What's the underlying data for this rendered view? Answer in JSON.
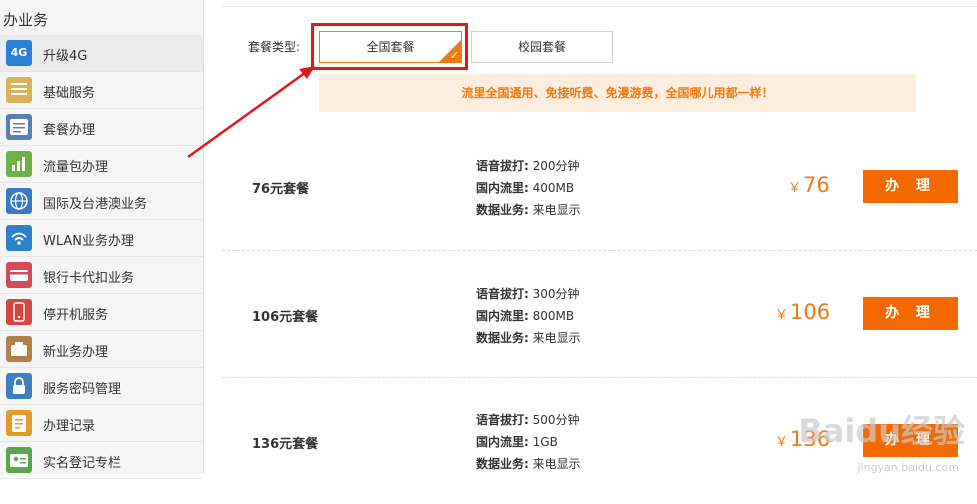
{
  "sidebar": {
    "title": "办业务",
    "items": [
      {
        "label": "升级4G",
        "icon": "4g-icon",
        "icon_text": "4G",
        "color": "#2a7fd4",
        "active": true
      },
      {
        "label": "基础服务",
        "icon": "basic-service-icon",
        "icon_text": "",
        "color": "#d9b25a",
        "active": false
      },
      {
        "label": "套餐办理",
        "icon": "plan-list-icon",
        "icon_text": "",
        "color": "#5a7fb2",
        "active": false
      },
      {
        "label": "流量包办理",
        "icon": "data-pack-icon",
        "icon_text": "",
        "color": "#6fb048",
        "active": false
      },
      {
        "label": "国际及台港澳业务",
        "icon": "globe-icon",
        "icon_text": "",
        "color": "#3a78c2",
        "active": false
      },
      {
        "label": "WLAN业务办理",
        "icon": "wlan-icon",
        "icon_text": "",
        "color": "#2c82c9",
        "active": false
      },
      {
        "label": "银行卡代扣业务",
        "icon": "bank-card-icon",
        "icon_text": "",
        "color": "#d24b5a",
        "active": false
      },
      {
        "label": "停开机服务",
        "icon": "phone-power-icon",
        "icon_text": "",
        "color": "#d4473e",
        "active": false
      },
      {
        "label": "新业务办理",
        "icon": "new-service-icon",
        "icon_text": "",
        "color": "#b08048",
        "active": false
      },
      {
        "label": "服务密码管理",
        "icon": "password-icon",
        "icon_text": "",
        "color": "#3d7fc1",
        "active": false
      },
      {
        "label": "办理记录",
        "icon": "record-icon",
        "icon_text": "",
        "color": "#e59b2a",
        "active": false
      },
      {
        "label": "实名登记专栏",
        "icon": "realname-icon",
        "icon_text": "",
        "color": "#5aa64a",
        "active": false
      }
    ]
  },
  "package_type": {
    "label": "套餐类型:",
    "tabs": [
      {
        "label": "全国套餐",
        "selected": true
      },
      {
        "label": "校园套餐",
        "selected": false
      }
    ]
  },
  "promo": "流里全国通用、免接听费、免漫游费，全国哪儿用都一样！",
  "plans": [
    {
      "name": "76元套餐",
      "features": [
        {
          "k": "语音拔打:",
          "v": "200分钟"
        },
        {
          "k": "国内流里:",
          "v": "400MB"
        },
        {
          "k": "数据业务:",
          "v": "来电显示"
        }
      ],
      "currency": "￥",
      "price": "76",
      "action": "办 理"
    },
    {
      "name": "106元套餐",
      "features": [
        {
          "k": "语音拔打:",
          "v": "300分钟"
        },
        {
          "k": "国内流里:",
          "v": "800MB"
        },
        {
          "k": "数据业务:",
          "v": "来电显示"
        }
      ],
      "currency": "￥",
      "price": "106",
      "action": "办 理"
    },
    {
      "name": "136元套餐",
      "features": [
        {
          "k": "语音拔打:",
          "v": "500分钟"
        },
        {
          "k": "国内流里:",
          "v": "1GB"
        },
        {
          "k": "数据业务:",
          "v": "来电显示"
        }
      ],
      "currency": "￥",
      "price": "136",
      "action": "办 理"
    }
  ],
  "watermark": {
    "text": "Baidu经验",
    "sub": "jingyan.baidu.com"
  },
  "colors": {
    "accent": "#f07a14",
    "button": "#f56a00",
    "highlight": "#e01919",
    "promo_bg": "#fbeedf"
  }
}
